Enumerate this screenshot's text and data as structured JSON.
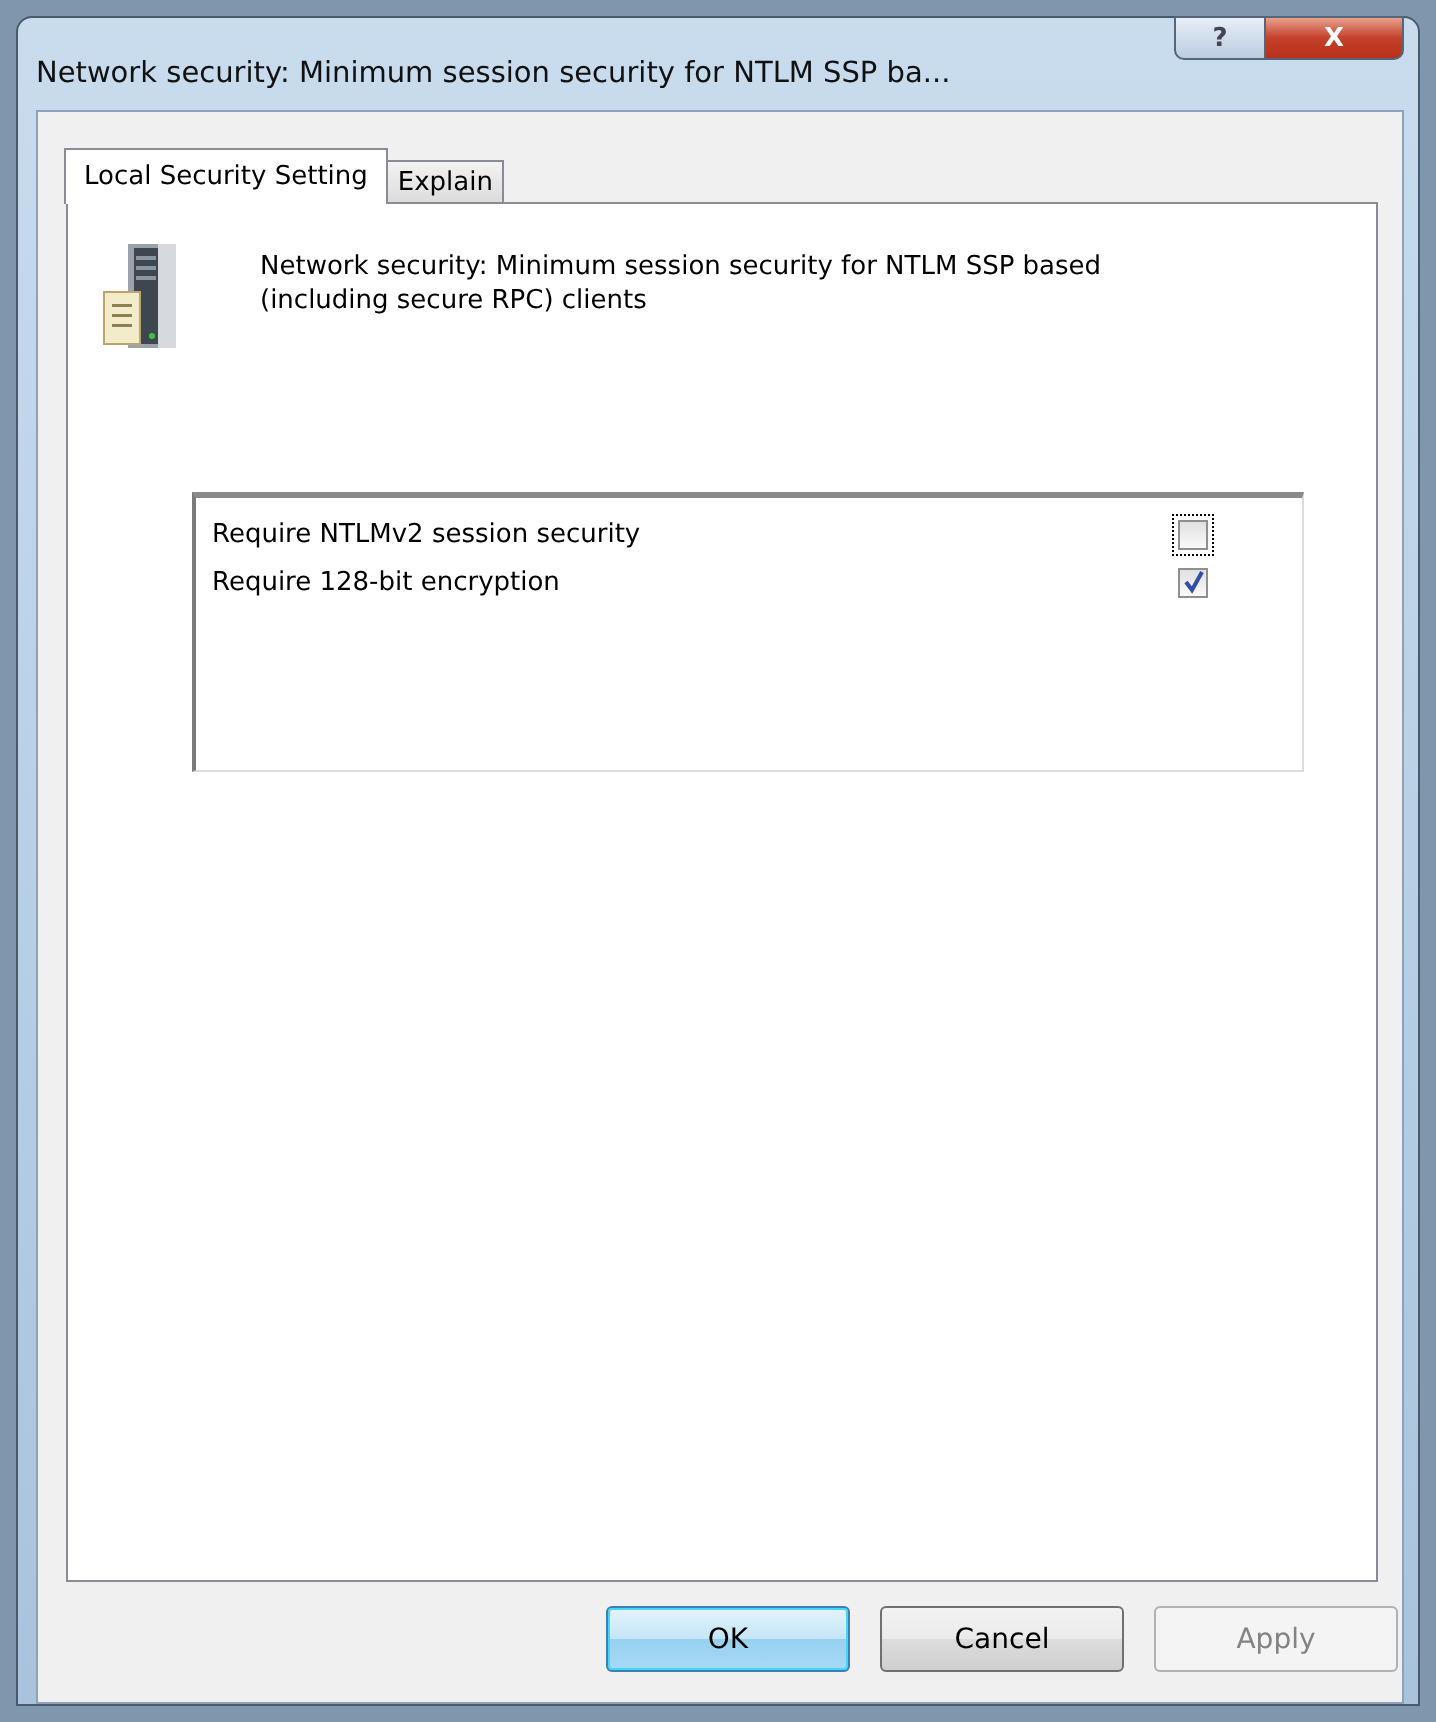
{
  "window": {
    "title": "Network security: Minimum session security for NTLM SSP ba...",
    "title_buttons": [
      {
        "kind": "help",
        "label": "?"
      },
      {
        "kind": "close",
        "label": "X"
      }
    ]
  },
  "tabs": [
    {
      "label": "Local Security Setting",
      "selected": true
    },
    {
      "label": "Explain",
      "selected": false
    }
  ],
  "description": "Network security: Minimum session security for NTLM SSP based (including secure RPC) clients",
  "options": [
    {
      "label": "Require NTLMv2 session security",
      "checked": false,
      "focused": true
    },
    {
      "label": "Require 128-bit encryption",
      "checked": true,
      "focused": false
    }
  ],
  "buttons": [
    {
      "label": "OK",
      "default": true,
      "disabled": false
    },
    {
      "label": "Cancel",
      "default": false,
      "disabled": false
    },
    {
      "label": "Apply",
      "default": false,
      "disabled": true
    }
  ]
}
